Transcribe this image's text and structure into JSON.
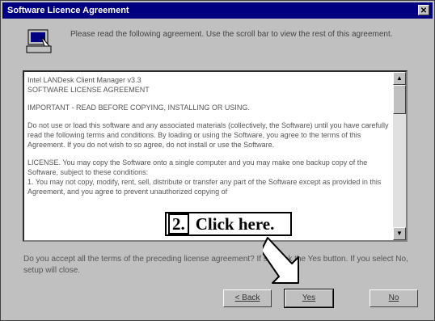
{
  "dialog": {
    "title": "Software Licence Agreement",
    "intro": "Please read the following agreement. Use the scroll bar to view the rest of this agreement.",
    "license_lines": [
      "Intel LANDesk Client Manager v3.3",
      "SOFTWARE LICENSE AGREEMENT"
    ],
    "important": "IMPORTANT - READ BEFORE COPYING, INSTALLING OR USING.",
    "para1": "Do not use or load this software and any associated materials (collectively, the Software) until you have carefully read the following terms and conditions. By loading or using the Software, you agree to the terms of this Agreement. If you do not wish to so agree, do not install or use the Software.",
    "para2": "LICENSE. You may copy the Software onto a single computer and you may make one backup copy of the Software, subject to these conditions:",
    "para3": "1. You may not copy, modify, rent, sell, distribute or transfer any part of the Software except as provided in this Agreement, and you agree to prevent unauthorized copying of",
    "question": "Do you accept all the terms of the preceding license agreement? If so, click the Yes button. If you select No, setup will close.",
    "buttons": {
      "back": "< Back",
      "yes": "Yes",
      "no": "No"
    }
  },
  "callout": {
    "number": "2.",
    "text": "Click here."
  }
}
